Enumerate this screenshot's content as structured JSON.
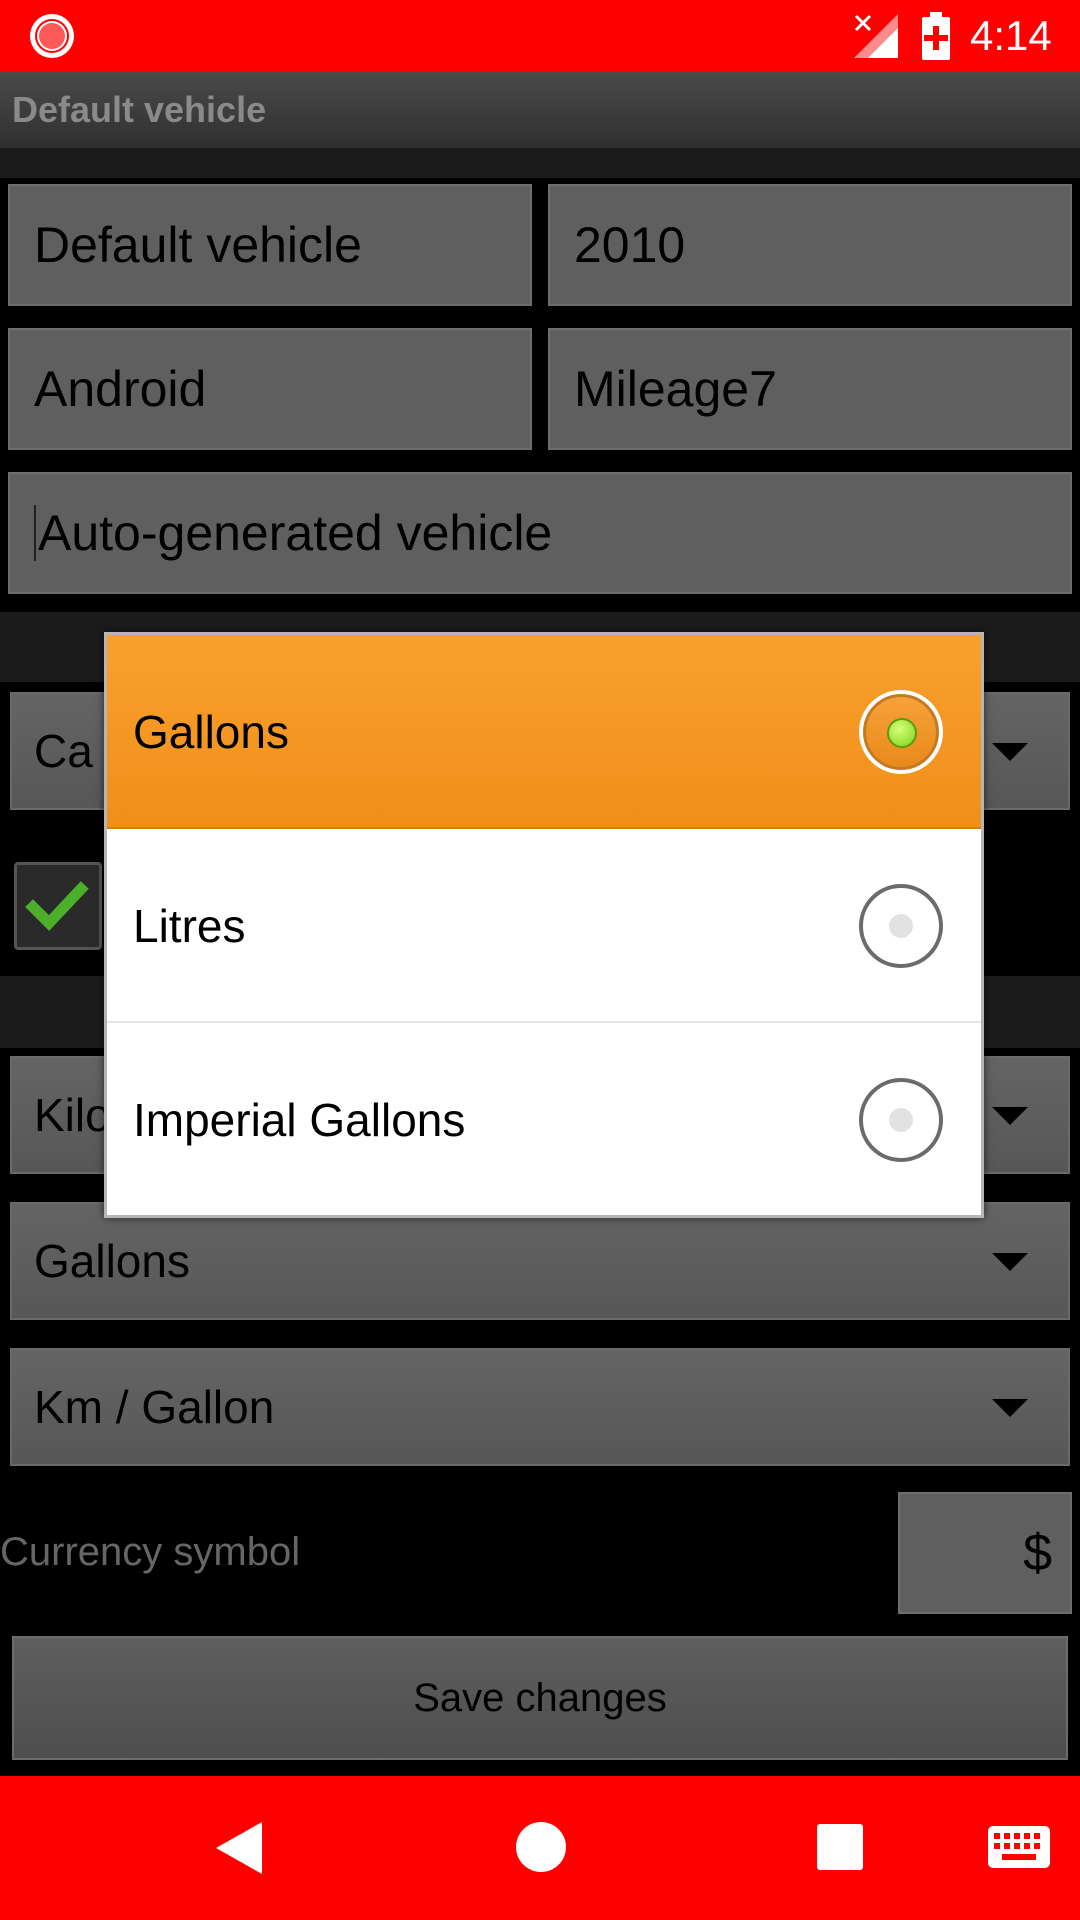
{
  "status_bar": {
    "time": "4:14",
    "bg_color": "#ff0000",
    "icons": [
      "record-icon",
      "signal-icon",
      "battery-icon"
    ]
  },
  "title_bar": {
    "title": "Default vehicle"
  },
  "form": {
    "vehicle_name": "Default vehicle",
    "year": "2010",
    "make": "Android",
    "model": "Mileage7",
    "description": "Auto-generated vehicle",
    "vehicle_type_partial": "Ca",
    "distance_unit_partial": "Kilo",
    "volume_unit": "Gallons",
    "economy_unit": "Km / Gallon",
    "currency_label": "Currency symbol",
    "currency_symbol": "$",
    "save_label": "Save changes"
  },
  "dialog": {
    "options": [
      {
        "label": "Gallons",
        "selected": true
      },
      {
        "label": "Litres",
        "selected": false
      },
      {
        "label": "Imperial Gallons",
        "selected": false
      }
    ],
    "selected_color": "#f5961f"
  },
  "nav_bar": {
    "bg_color": "#ff0000",
    "icons": [
      "back-icon",
      "home-icon",
      "recents-icon",
      "keyboard-icon"
    ]
  }
}
